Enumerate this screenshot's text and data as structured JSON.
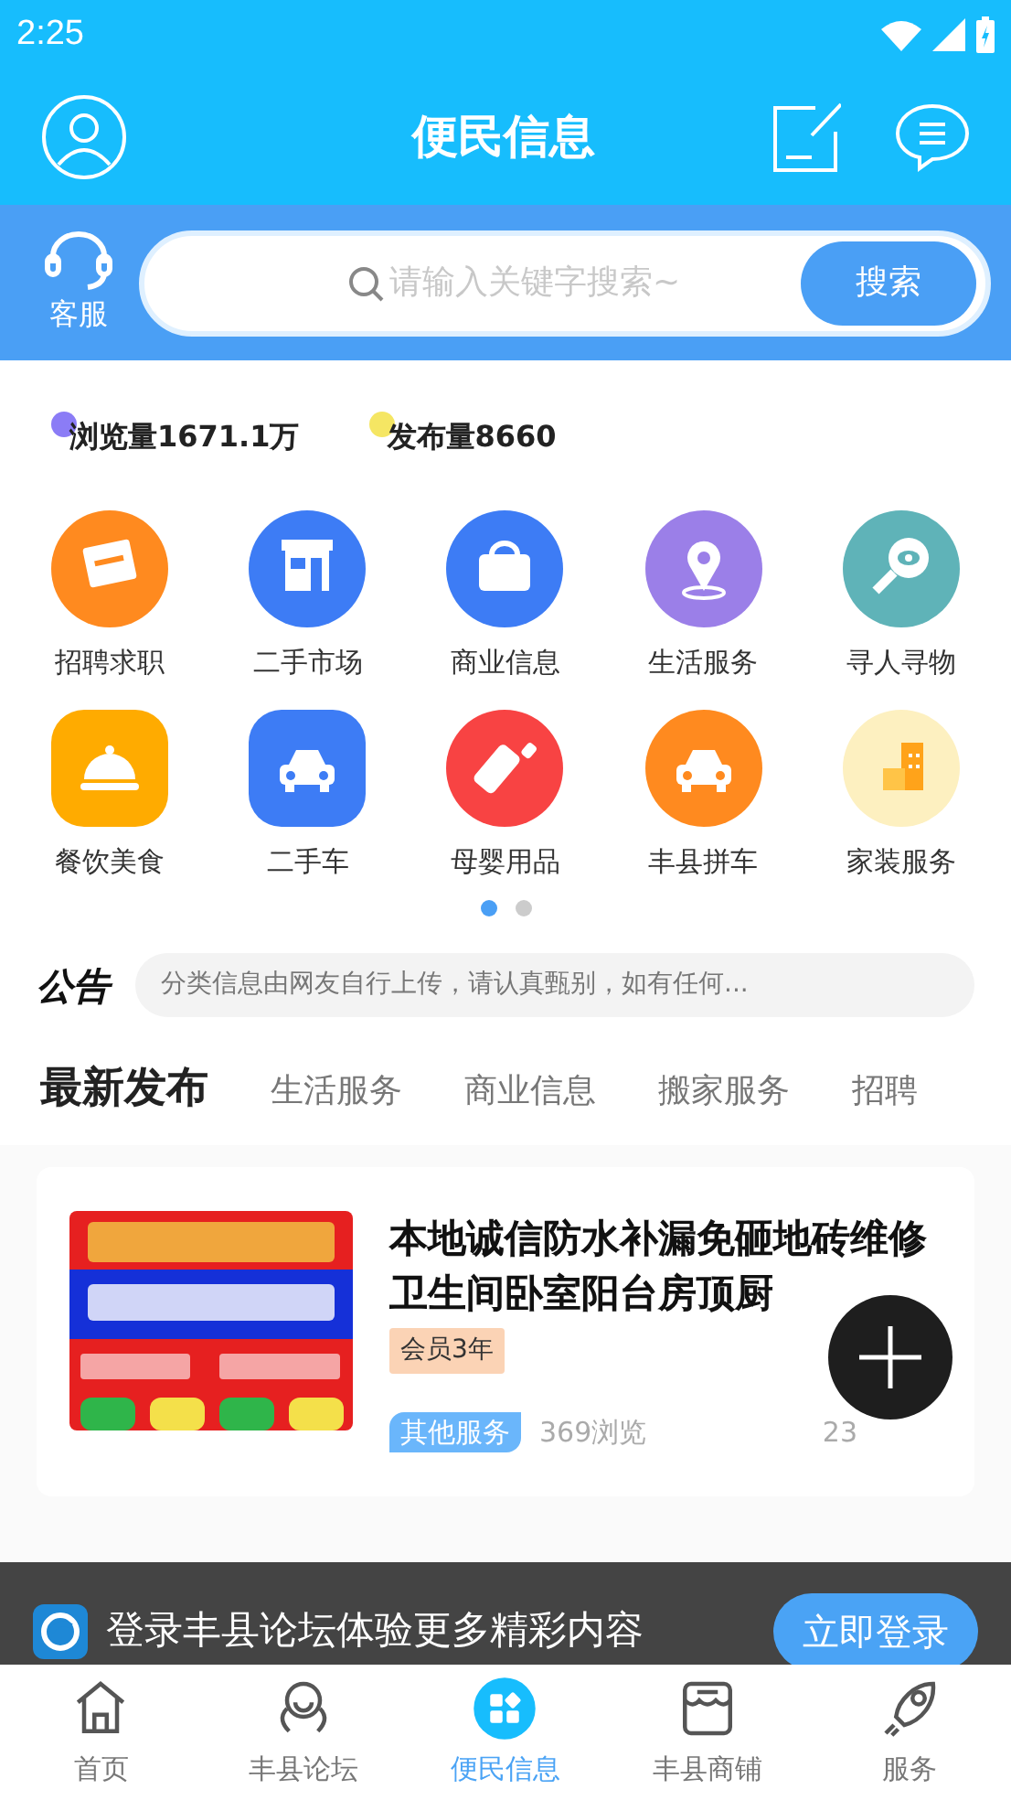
{
  "status_bar": {
    "time": "2:25"
  },
  "header": {
    "title": "便民信息"
  },
  "search": {
    "service_label": "客服",
    "placeholder": "请输入关键字搜索~",
    "button": "搜索"
  },
  "stats": [
    {
      "label": "浏览量1671.1万",
      "color": "#8b7cf6"
    },
    {
      "label": "发布量8660",
      "color": "#f5e663"
    }
  ],
  "categories": [
    {
      "label": "招聘求职",
      "color": "#ff8a1f"
    },
    {
      "label": "二手市场",
      "color": "#3d7cf5"
    },
    {
      "label": "商业信息",
      "color": "#3d7cf5"
    },
    {
      "label": "生活服务",
      "color": "#9b7fe8"
    },
    {
      "label": "寻人寻物",
      "color": "#5fb3b8"
    },
    {
      "label": "餐饮美食",
      "color": "#ffab00"
    },
    {
      "label": "二手车",
      "color": "#3d7cf5"
    },
    {
      "label": "母婴用品",
      "color": "#f84343"
    },
    {
      "label": "丰县拼车",
      "color": "#ff8a1f"
    },
    {
      "label": "家装服务",
      "color": "#fdf0c0"
    }
  ],
  "pager": [
    {
      "selected": true
    },
    {
      "selected": false
    }
  ],
  "notice": {
    "title": "公告",
    "text": "分类信息由网友自行上传，请认真甄别，如有任何..."
  },
  "tabs": [
    {
      "label": "最新发布",
      "selected": true
    },
    {
      "label": "生活服务",
      "selected": false
    },
    {
      "label": "商业信息",
      "selected": false
    },
    {
      "label": "搬家服务",
      "selected": false
    },
    {
      "label": "招聘",
      "selected": false
    }
  ],
  "listings": [
    {
      "title": "本地诚信防水补漏免砸地砖维修卫生间卧室阳台房顶厨",
      "badge": "会员3年",
      "category": "其他服务",
      "views": "369浏览",
      "time": "23"
    }
  ],
  "login_banner": {
    "text": "登录丰县论坛体验更多精彩内容",
    "button": "立即登录"
  },
  "bottom_nav": [
    {
      "label": "首页",
      "selected": false
    },
    {
      "label": "丰县论坛",
      "selected": false
    },
    {
      "label": "便民信息",
      "selected": true
    },
    {
      "label": "丰县商铺",
      "selected": false
    },
    {
      "label": "服务",
      "selected": false
    }
  ]
}
